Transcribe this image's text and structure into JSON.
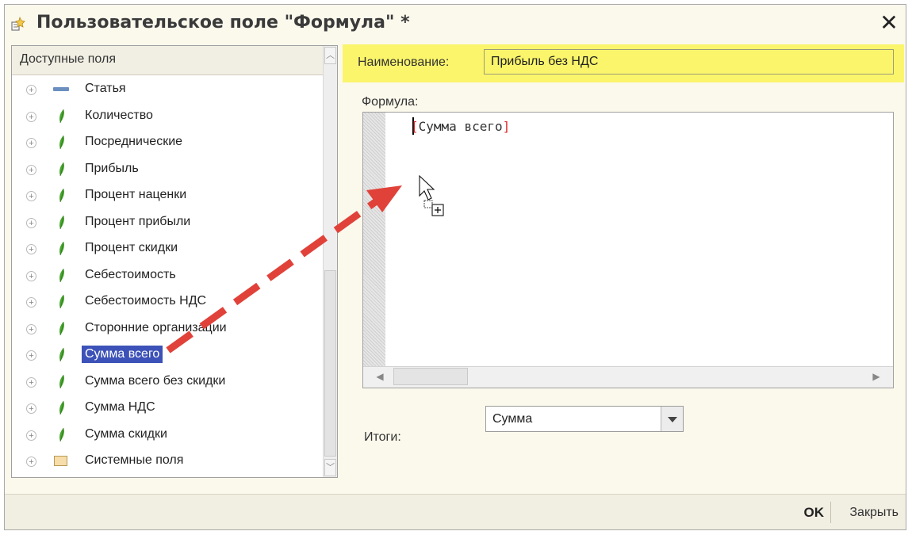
{
  "window": {
    "title": "Пользовательское поле \"Формула\" *"
  },
  "fields_panel": {
    "header": "Доступные поля",
    "items": [
      {
        "label": "Статья",
        "icon": "dash-icon"
      },
      {
        "label": "Количество",
        "icon": "leaf-icon"
      },
      {
        "label": "Посреднические",
        "icon": "leaf-icon"
      },
      {
        "label": "Прибыль",
        "icon": "leaf-icon"
      },
      {
        "label": "Процент наценки",
        "icon": "leaf-icon"
      },
      {
        "label": "Процент прибыли",
        "icon": "leaf-icon"
      },
      {
        "label": "Процент скидки",
        "icon": "leaf-icon"
      },
      {
        "label": "Себестоимость",
        "icon": "leaf-icon"
      },
      {
        "label": "Себестоимость НДС",
        "icon": "leaf-icon"
      },
      {
        "label": "Сторонние организации",
        "icon": "leaf-icon"
      },
      {
        "label": "Сумма всего",
        "icon": "leaf-icon",
        "selected": true
      },
      {
        "label": "Сумма всего без скидки",
        "icon": "leaf-icon"
      },
      {
        "label": "Сумма НДС",
        "icon": "leaf-icon"
      },
      {
        "label": "Сумма скидки",
        "icon": "leaf-icon"
      },
      {
        "label": "Системные поля",
        "icon": "folder-icon"
      }
    ]
  },
  "name_field": {
    "label": "Наименование:",
    "value": "Прибыль без НДС"
  },
  "formula": {
    "label": "Формула:",
    "open": "[",
    "text": "Сумма всего",
    "close": "]"
  },
  "totals": {
    "label": "Итоги:",
    "value": "Сумма"
  },
  "buttons": {
    "ok": "OK",
    "close": "Закрыть"
  },
  "colors": {
    "highlight": "#fbf56b",
    "selection": "#3c52b8",
    "arrow": "#e0423a",
    "bracket": "#e0282a"
  }
}
